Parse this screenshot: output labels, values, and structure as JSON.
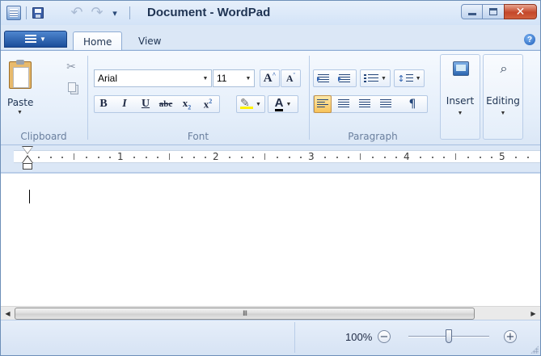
{
  "window": {
    "title": "Document - WordPad"
  },
  "qat": {
    "app_icon": "wordpad-icon",
    "save_icon": "save-icon",
    "undo_icon": "undo-icon",
    "redo_icon": "redo-icon",
    "customize_glyph": "▾"
  },
  "window_controls": {
    "minimize_icon": "minimize-icon",
    "maximize_icon": "maximize-icon",
    "close_glyph": "✕"
  },
  "ribbon": {
    "tabs": [
      {
        "label": "Home",
        "active": true
      },
      {
        "label": "View",
        "active": false
      }
    ],
    "help_glyph": "?",
    "clipboard": {
      "label": "Clipboard",
      "paste_label": "Paste",
      "cut_glyph": "✂"
    },
    "font": {
      "label": "Font",
      "family": "Arial",
      "size": "11",
      "grow_glyph": "A",
      "shrink_glyph": "A",
      "bold": "B",
      "italic": "I",
      "underline": "U",
      "strikethrough": "abc",
      "subscript": "x",
      "superscript": "x",
      "sub_mark": "2",
      "sup_mark": "2",
      "color_glyph": "A",
      "highlight_color": "#fff200",
      "text_color": "#000000"
    },
    "paragraph": {
      "label": "Paragraph",
      "active_alignment": "left",
      "para_glyph": "¶"
    },
    "insert": {
      "label": "Insert"
    },
    "editing": {
      "label": "Editing",
      "icon_glyph": "🔭"
    }
  },
  "ruler": {
    "numbers": [
      "1",
      "2",
      "3",
      "4",
      "5"
    ]
  },
  "scrollbar": {
    "left_glyph": "◀",
    "right_glyph": "▶",
    "grip": "III"
  },
  "status": {
    "zoom_label": "100%",
    "zoom_out_glyph": "−",
    "zoom_in_glyph": "+",
    "zoom_value": 100
  },
  "colors": {
    "accent": "#1a4d9a",
    "close_red": "#c4472a",
    "active_button": "#f7c35a"
  }
}
